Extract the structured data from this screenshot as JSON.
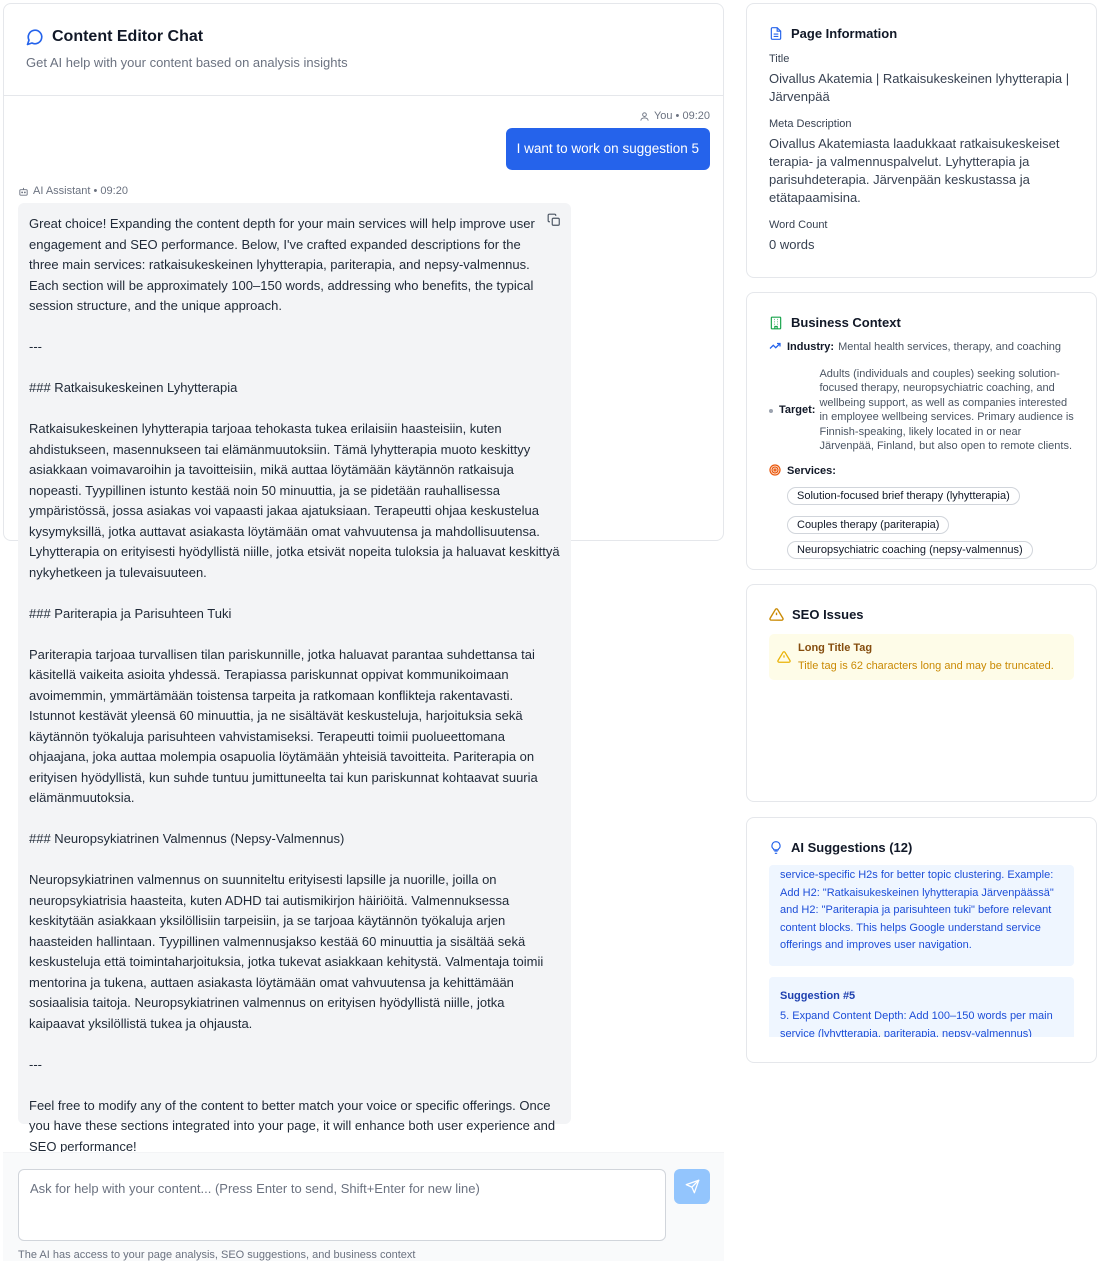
{
  "chat": {
    "title": "Content Editor Chat",
    "subtitle": "Get AI help with your content based on analysis insights",
    "user_meta": "You • 09:20",
    "user_message": "I want to work on suggestion 5",
    "ai_meta": "AI Assistant • 09:20",
    "ai_paragraphs": [
      "Great choice! Expanding the content depth for your main services will help improve user engagement and SEO performance. Below, I've crafted expanded descriptions for the three main services: ratkaisukeskeinen lyhytterapia, pariterapia, and nepsy-valmennus. Each section will be approximately 100–150 words, addressing who benefits, the typical session structure, and the unique approach.",
      "---",
      "### Ratkaisukeskeinen Lyhytterapia",
      "Ratkaisukeskeinen lyhytterapia tarjoaa tehokasta tukea erilaisiin haasteisiin, kuten ahdistukseen, masennukseen tai elämänmuutoksiin. Tämä lyhytterapia muoto keskittyy asiakkaan voimavaroihin ja tavoitteisiin, mikä auttaa löytämään käytännön ratkaisuja nopeasti. Tyypillinen istunto kestää noin 50 minuuttia, ja se pidetään rauhallisessa ympäristössä, jossa asiakas voi vapaasti jakaa ajatuksiaan. Terapeutti ohjaa keskustelua kysymyksillä, jotka auttavat asiakasta löytämään omat vahvuutensa ja mahdollisuutensa. Lyhytterapia on erityisesti hyödyllistä niille, jotka etsivät nopeita tuloksia ja haluavat keskittyä nykyhetkeen ja tulevaisuuteen.",
      "### Pariterapia ja Parisuhteen Tuki",
      "Pariterapia tarjoaa turvallisen tilan pariskunnille, jotka haluavat parantaa suhdettansa tai käsitellä vaikeita asioita yhdessä. Terapiassa pariskunnat oppivat kommunikoimaan avoimemmin, ymmärtämään toistensa tarpeita ja ratkomaan konflikteja rakentavasti. Istunnot kestävät yleensä 60 minuuttia, ja ne sisältävät keskusteluja, harjoituksia sekä käytännön työkaluja parisuhteen vahvistamiseksi. Terapeutti toimii puolueettomana ohjaajana, joka auttaa molempia osapuolia löytämään yhteisiä tavoitteita. Pariterapia on erityisen hyödyllistä, kun suhde tuntuu jumittuneelta tai kun pariskunnat kohtaavat suuria elämänmuutoksia.",
      "### Neuropsykiatrinen Valmennus (Nepsy-Valmennus)",
      "Neuropsykiatrinen valmennus on suunniteltu erityisesti lapsille ja nuorille, joilla on neuropsykiatrisia haasteita, kuten ADHD tai autismikirjon häiriöitä. Valmennuksessa keskitytään asiakkaan yksilöllisiin tarpeisiin, ja se tarjoaa käytännön työkaluja arjen haasteiden hallintaan. Tyypillinen valmennusjakso kestää 60 minuuttia ja sisältää sekä keskusteluja että toimintaharjoituksia, jotka tukevat asiakkaan kehitystä. Valmentaja toimii mentorina ja tukena, auttaen asiakasta löytämään omat vahvuutensa ja kehittämään sosiaalisia taitoja. Neuropsykiatrinen valmennus on erityisen hyödyllistä niille, jotka kaipaavat yksilöllistä tukea ja ohjausta.",
      "---",
      "Feel free to modify any of the content to better match your voice or specific offerings. Once you have these sections integrated into your page, it will enhance both user experience and SEO performance!"
    ],
    "input_placeholder": "Ask for help with your content... (Press Enter to send, Shift+Enter for new line)",
    "note": "The AI has access to your page analysis, SEO suggestions, and business context"
  },
  "page_info": {
    "heading": "Page Information",
    "title_label": "Title",
    "title_value": "Oivallus Akatemia | Ratkaisukeskeinen lyhytterapia | Järvenpää",
    "meta_label": "Meta Description",
    "meta_value": "Oivallus Akatemiasta laadukkaat ratkaisukeskeiset terapia- ja valmennuspalvelut. Lyhytterapia ja parisuhdeterapia. Järvenpään keskustassa ja etätapaamisina.",
    "wc_label": "Word Count",
    "wc_value": "0 words"
  },
  "business": {
    "heading": "Business Context",
    "industry_label": "Industry:",
    "industry_value": "Mental health services, therapy, and coaching",
    "target_label": "Target:",
    "target_value": "Adults (individuals and couples) seeking solution-focused therapy, neuropsychiatric coaching, and wellbeing support, as well as companies interested in employee wellbeing services. Primary audience is Finnish-speaking, likely located in or near Järvenpää, Finland, but also open to remote clients.",
    "services_label": "Services:",
    "services": [
      "Solution-focused brief therapy (lyhytterapia)",
      "Couples therapy (pariterapia)",
      "Neuropsychiatric coaching (nepsy-valmennus)"
    ]
  },
  "seo": {
    "heading": "SEO Issues",
    "issue_title": "Long Title Tag",
    "issue_text": "Title tag is 62 characters long and may be truncated."
  },
  "suggestions": {
    "heading": "AI Suggestions (12)",
    "item1_text": "service-specific H2s for better topic clustering. Example: Add H2: \"Ratkaisukeskeinen lyhytterapia Järvenpäässä\" and H2: \"Pariterapia ja parisuhteen tuki\" before relevant content blocks. This helps Google understand service offerings and improves user navigation.",
    "item2_title": "Suggestion #5",
    "item2_text": "5. Expand Content Depth: Add 100–150 words per main service (lyhytterapia, pariterapia, nepsy-valmennus)"
  },
  "colors": {
    "accent": "#2563eb",
    "warning_bg": "#fefce8",
    "suggestion_bg": "#eff6ff"
  }
}
